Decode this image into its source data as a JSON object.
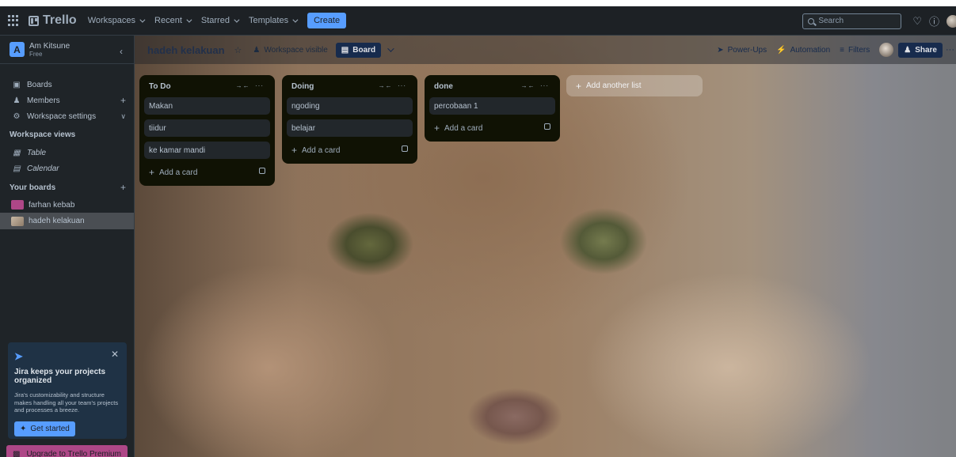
{
  "topnav": {
    "logo_text": "Trello",
    "menus": [
      "Workspaces",
      "Recent",
      "Starred",
      "Templates"
    ],
    "create_label": "Create",
    "search_placeholder": "Search",
    "icons": [
      "apps-grid-icon",
      "notification-icon",
      "help-icon",
      "account-avatar"
    ]
  },
  "sidebar": {
    "workspace_initial": "A",
    "workspace_name": "Am Kitsune",
    "workspace_plan": "Free",
    "items": [
      {
        "label": "Boards",
        "icon": "board-icon"
      },
      {
        "label": "Members",
        "icon": "members-icon"
      },
      {
        "label": "Workspace settings",
        "icon": "settings-icon"
      }
    ],
    "views_heading": "Workspace views",
    "views": [
      {
        "label": "Table",
        "icon": "table-icon"
      },
      {
        "label": "Calendar",
        "icon": "calendar-icon"
      }
    ],
    "boards_heading": "Your boards",
    "boards": [
      {
        "label": "farhan kebab",
        "color": "#ae4787"
      },
      {
        "label": "hadeh kelakuan",
        "color": "#b0a08c"
      }
    ],
    "jira": {
      "title": "Jira keeps your projects organized",
      "body": "Jira's customizability and structure makes handling all your team's projects and processes a breeze.",
      "button": "Get started"
    },
    "premium_label": "Upgrade to Trello Premium"
  },
  "board": {
    "title": "hadeh kelakuan",
    "visibility": "Workspace visible",
    "view_label": "Board",
    "powerups": "Power-Ups",
    "automation": "Automation",
    "filters": "Filters",
    "share": "Share",
    "add_list": "Add another list",
    "add_card": "Add a card",
    "lists": [
      {
        "title": "To Do",
        "cards": [
          "Makan",
          "tiidur",
          "ke kamar mandi"
        ]
      },
      {
        "title": "Doing",
        "cards": [
          "ngoding",
          "belajar"
        ]
      },
      {
        "title": "done",
        "cards": [
          "percobaan 1"
        ]
      }
    ]
  },
  "colors": {
    "accent": "#579dff",
    "premium": "#ae4787",
    "nav_bg": "#1d2125",
    "list_bg": "#101204",
    "card_bg": "#22272b"
  }
}
